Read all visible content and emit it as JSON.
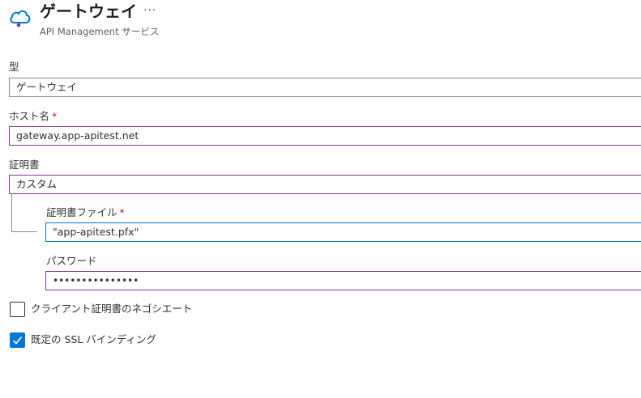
{
  "header": {
    "title": "ゲートウェイ",
    "more": "···",
    "subtitle": "API Management サービス",
    "icon": "cloud-api-management-icon"
  },
  "fields": {
    "type": {
      "label": "型",
      "value": "ゲートウェイ"
    },
    "hostname": {
      "label": "ホスト名",
      "required": "*",
      "value": "gateway.app-apitest.net"
    },
    "certificate": {
      "label": "証明書",
      "value": "カスタム"
    },
    "certificate_file": {
      "label": "証明書ファイル",
      "required": "*",
      "value": "\"app-apitest.pfx\""
    },
    "password": {
      "label": "パスワード",
      "value": "•••••••••••••••"
    }
  },
  "checkboxes": {
    "client_cert": {
      "label": "クライアント証明書のネゴシエート",
      "checked": false
    },
    "default_ssl": {
      "label": "既定の SSL バインディング",
      "checked": true
    }
  },
  "colors": {
    "accent": "#0078d4",
    "required": "#a4262c",
    "invalid_border": "#7a3b8a"
  }
}
